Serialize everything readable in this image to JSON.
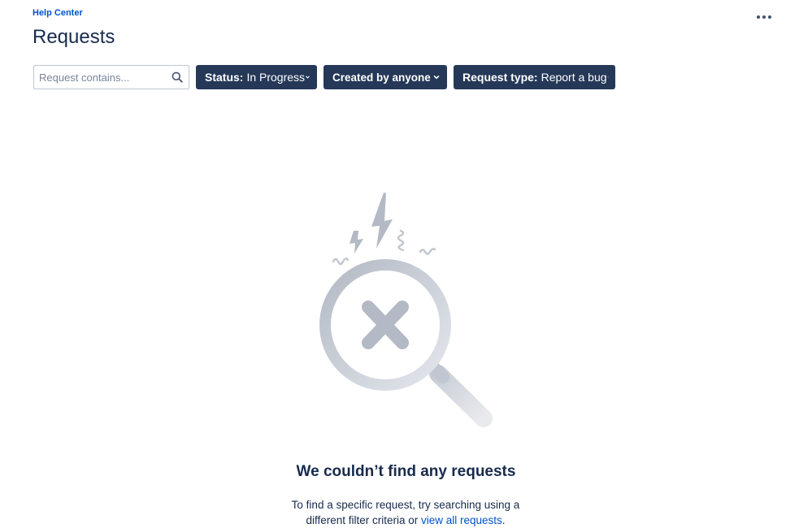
{
  "breadcrumb": {
    "label": "Help Center"
  },
  "page": {
    "title": "Requests"
  },
  "header": {
    "more_icon": "more-horizontal-icon"
  },
  "filters": {
    "search": {
      "placeholder": "Request contains...",
      "value": "",
      "icon": "search-icon"
    },
    "status": {
      "key": "Status:",
      "value": "In Progress"
    },
    "created_by": {
      "label": "Created by anyone"
    },
    "request_type": {
      "key": "Request type:",
      "value": "Report a bug"
    },
    "chevron_icon": "chevron-down-icon"
  },
  "empty_state": {
    "illustration_icon": "magnifier-error-icon",
    "title": "We couldn’t find any requests",
    "message_line1": "To find a specific request, try searching using a",
    "message_line2": "different filter criteria or ",
    "link_label": "view all requests",
    "message_end": "."
  },
  "colors": {
    "brand_link": "#0052cc",
    "filter_bg": "#253858",
    "text_primary": "#172b4d",
    "illustration_grey": "#c1c7d0"
  }
}
